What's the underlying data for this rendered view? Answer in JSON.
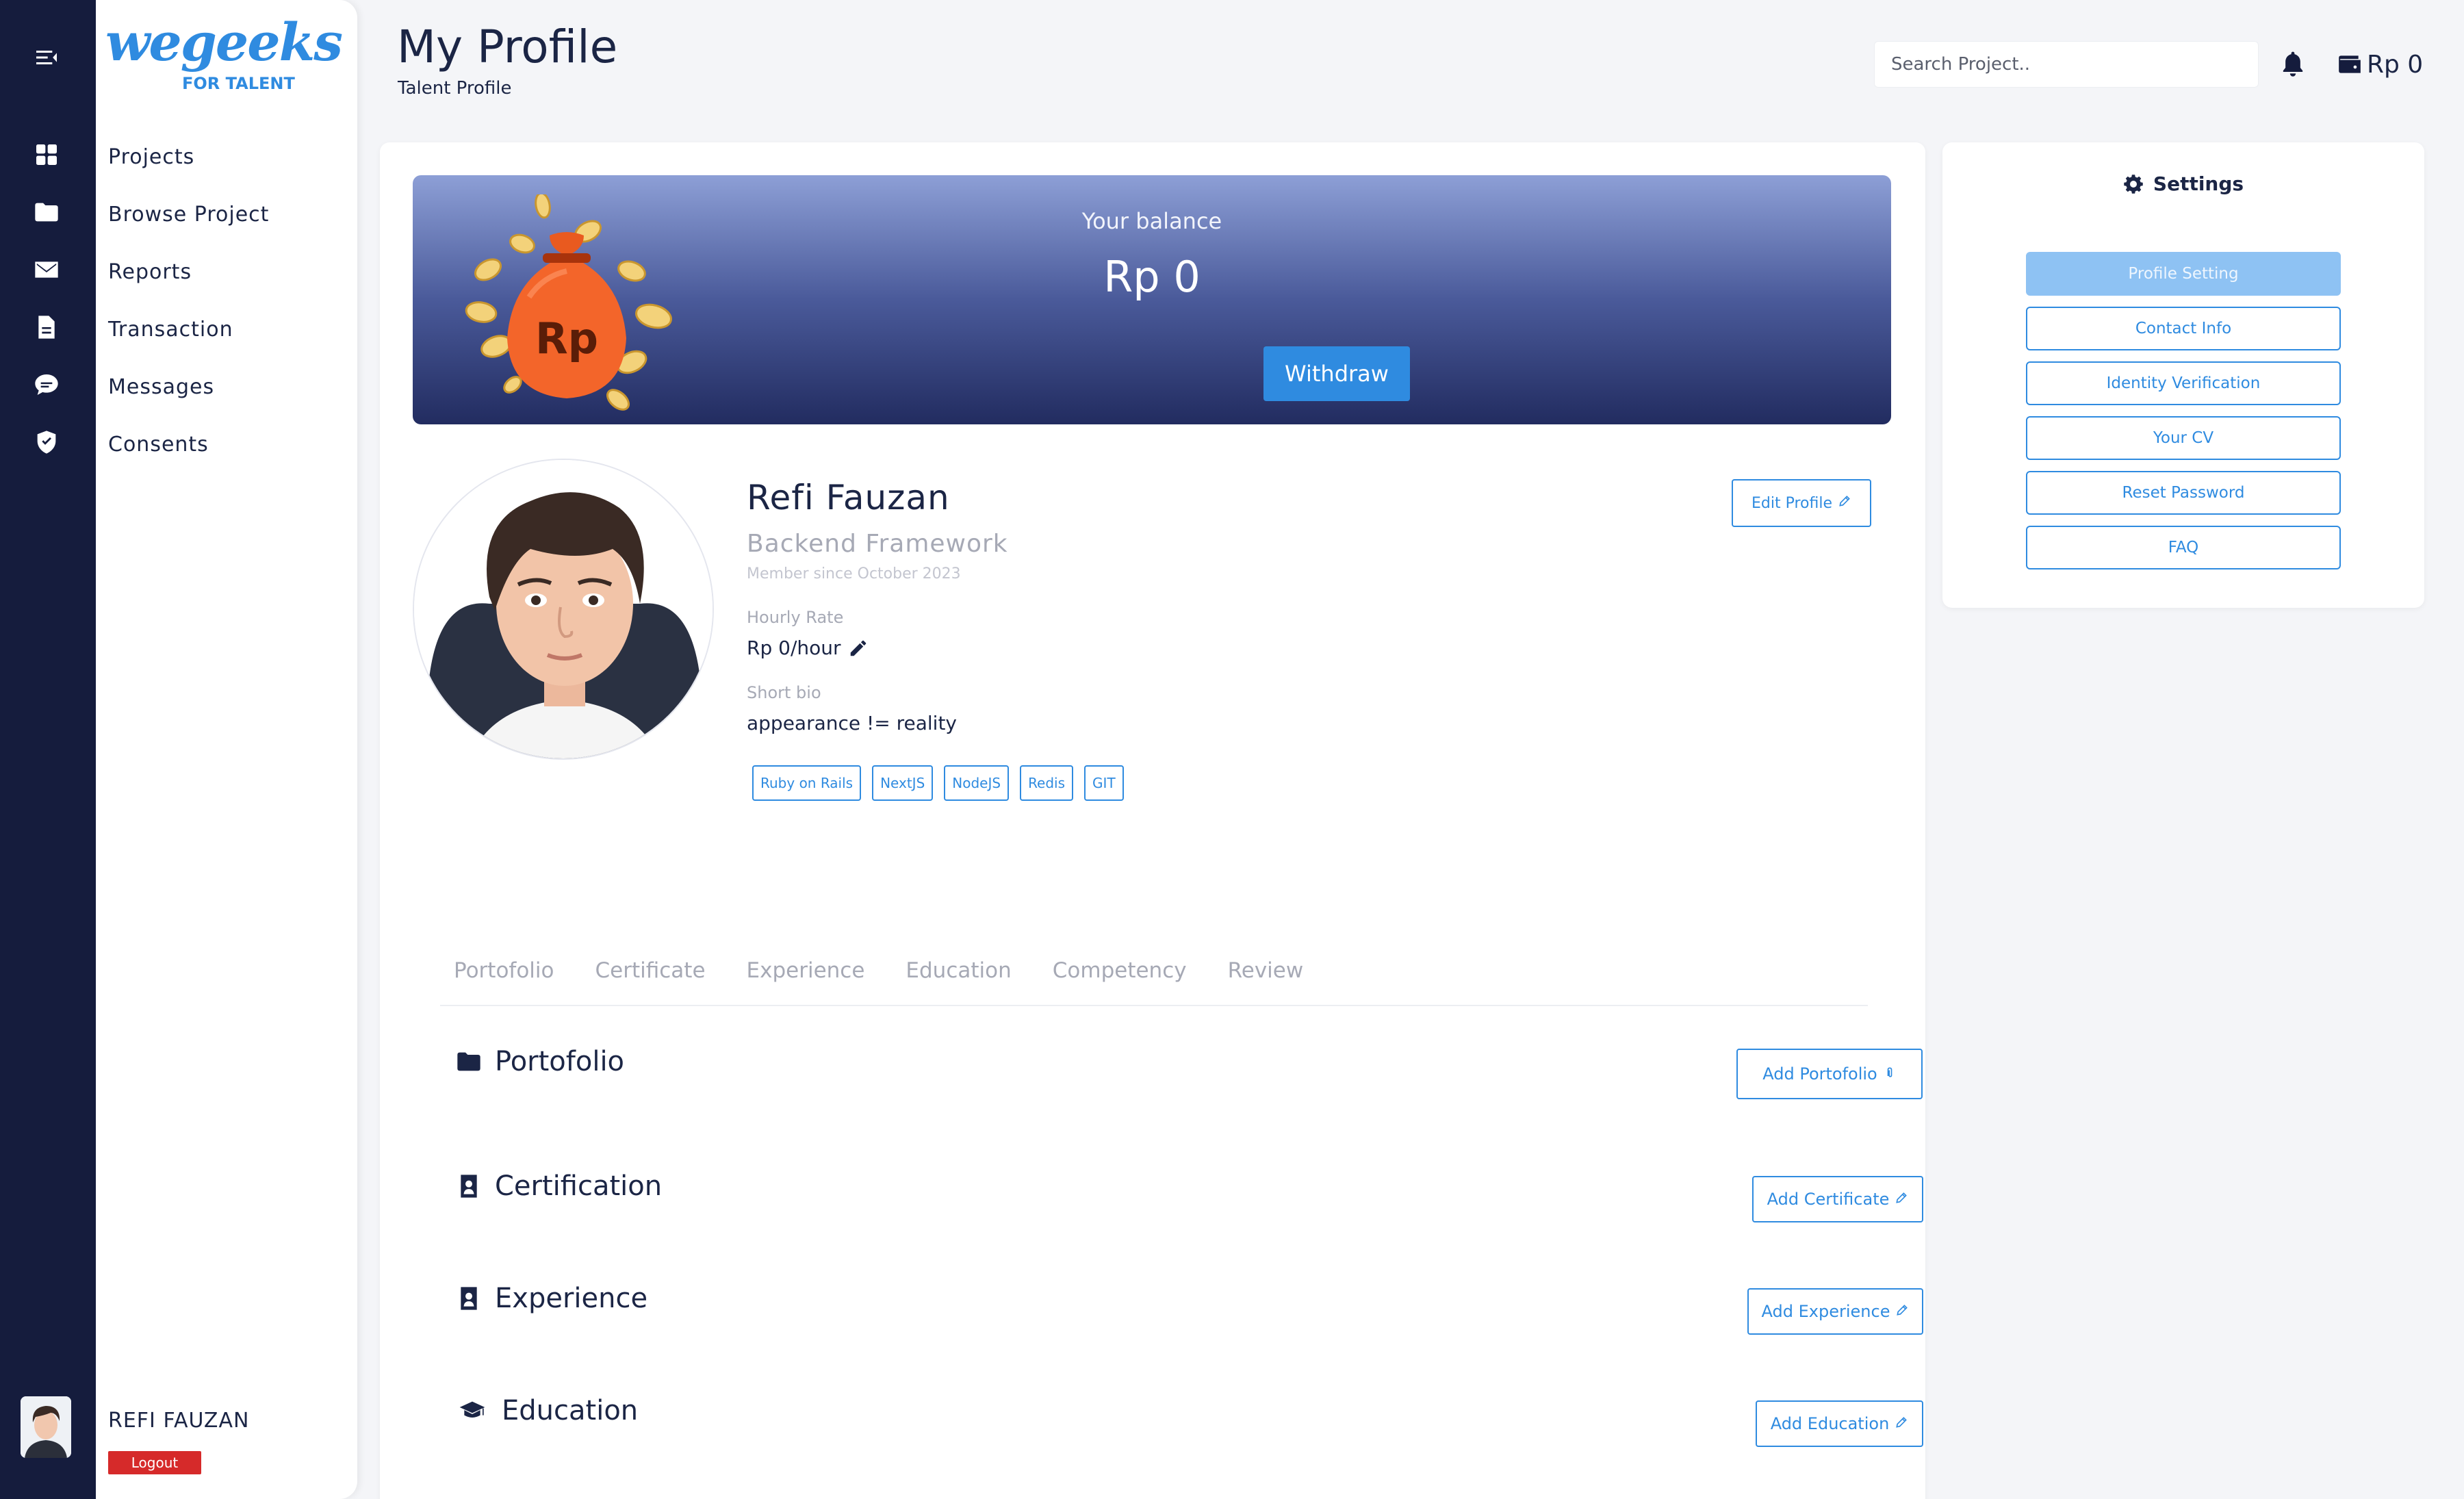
{
  "brand": {
    "logo_word": "wegeeks",
    "logo_sub": "FOR TALENT"
  },
  "rail_icons": [
    "menu-collapse-icon",
    "grid-icon",
    "folder-icon",
    "envelope-icon",
    "document-icon",
    "chat-icon",
    "shield-icon"
  ],
  "sidebar": {
    "items": [
      {
        "label": "Projects",
        "icon": "grid-icon"
      },
      {
        "label": "Browse Project",
        "icon": "folder-icon"
      },
      {
        "label": "Reports",
        "icon": "envelope-icon"
      },
      {
        "label": "Transaction",
        "icon": "document-icon"
      },
      {
        "label": "Messages",
        "icon": "chat-icon"
      },
      {
        "label": "Consents",
        "icon": "shield-icon"
      }
    ],
    "user_name": "REFI FAUZAN",
    "logout_label": "Logout"
  },
  "header": {
    "title": "My Profile",
    "subtitle": "Talent Profile",
    "search_placeholder": "Search Project..",
    "wallet_amount": "Rp 0"
  },
  "balance": {
    "label": "Your balance",
    "value": "Rp 0",
    "withdraw_label": "Withdraw",
    "bag_text": "Rp"
  },
  "profile": {
    "name": "Refi Fauzan",
    "role": "Backend Framework",
    "member_since": "Member since October 2023",
    "hourly_rate_label": "Hourly Rate",
    "hourly_rate": "Rp 0/hour",
    "short_bio_label": "Short bio",
    "short_bio": "appearance != reality",
    "skills": [
      "Ruby on Rails",
      "NextJS",
      "NodeJS",
      "Redis",
      "GIT"
    ],
    "edit_label": "Edit Profile"
  },
  "tabs": [
    "Portofolio",
    "Certificate",
    "Experience",
    "Education",
    "Competency",
    "Review"
  ],
  "sections": [
    {
      "title": "Portofolio",
      "button": "Add Portofolio"
    },
    {
      "title": "Certification",
      "button": "Add Certificate"
    },
    {
      "title": "Experience",
      "button": "Add Experience"
    },
    {
      "title": "Education",
      "button": "Add Education"
    }
  ],
  "settings": {
    "title": "Settings",
    "items": [
      "Profile Setting",
      "Contact Info",
      "Identity Verification",
      "Your CV",
      "Reset Password",
      "FAQ"
    ],
    "active": "Profile Setting"
  },
  "colors": {
    "accent": "#2f8be0",
    "dark": "#151c3d",
    "logout": "#d62a2a",
    "active_setting": "#8ec2f3"
  }
}
